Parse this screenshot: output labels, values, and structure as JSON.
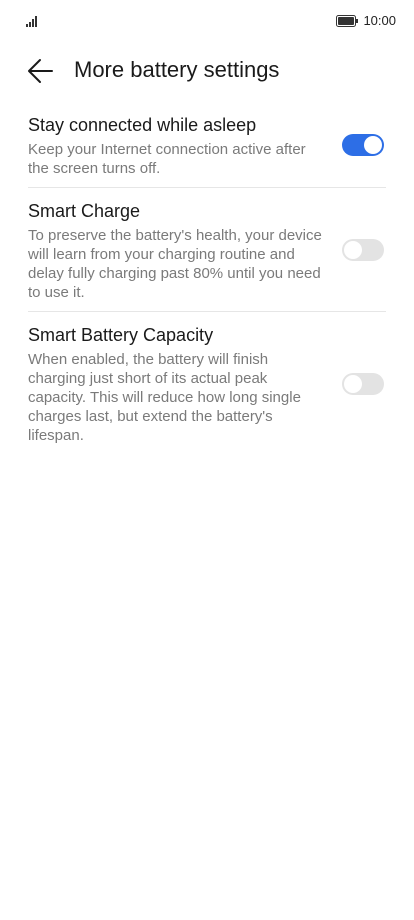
{
  "status_bar": {
    "signal_icon": "signal-bars-icon",
    "battery_icon": "battery-full-icon",
    "time": "10:00"
  },
  "header": {
    "back_icon": "arrow-left-icon",
    "title": "More battery settings"
  },
  "settings": [
    {
      "title": "Stay connected while asleep",
      "description": "Keep your Internet connection active after the screen turns off.",
      "enabled": true
    },
    {
      "title": "Smart Charge",
      "description": "To preserve the battery's health, your device will learn from your charging routine and delay fully charging past 80% until you need to use it.",
      "enabled": false
    },
    {
      "title": "Smart Battery Capacity",
      "description": "When enabled, the battery will finish charging just short of its actual peak capacity. This will reduce how long single charges last, but extend the battery's lifespan.",
      "enabled": false
    }
  ],
  "colors": {
    "toggle_on": "#2d6ee6",
    "toggle_off": "#e3e3e3"
  }
}
